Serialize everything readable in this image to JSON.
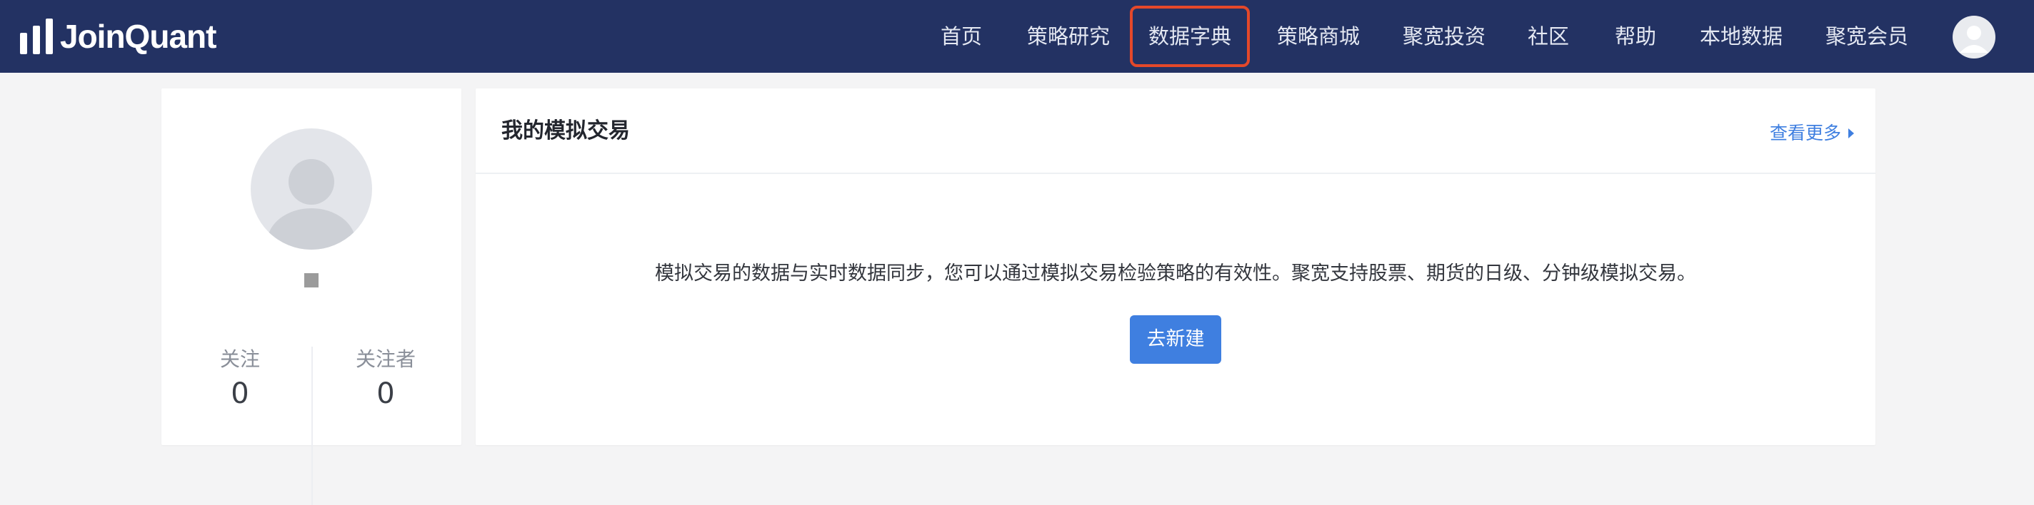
{
  "brand": {
    "name": "JoinQuant"
  },
  "nav": {
    "items": [
      {
        "label": "首页"
      },
      {
        "label": "策略研究"
      },
      {
        "label": "数据字典",
        "active": true
      },
      {
        "label": "策略商城"
      },
      {
        "label": "聚宽投资"
      },
      {
        "label": "社区"
      },
      {
        "label": "帮助"
      },
      {
        "label": "本地数据"
      },
      {
        "label": "聚宽会员"
      }
    ],
    "active_highlight_color": "#e4482a",
    "background_color": "#233263"
  },
  "profile": {
    "following_label": "关注",
    "following_count": "0",
    "followers_label": "关注者",
    "followers_count": "0"
  },
  "sim_trading": {
    "title": "我的模拟交易",
    "more_label": "查看更多",
    "description": "模拟交易的数据与实时数据同步，您可以通过模拟交易检验策略的有效性。聚宽支持股票、期货的日级、分钟级模拟交易。",
    "new_button_label": "去新建",
    "accent_color": "#3f7fe0"
  },
  "icons": {
    "logo": "bar-chart-logo-icon",
    "nav_avatar": "user-avatar-icon",
    "profile_avatar": "user-avatar-icon",
    "more_caret": "caret-right-icon"
  }
}
